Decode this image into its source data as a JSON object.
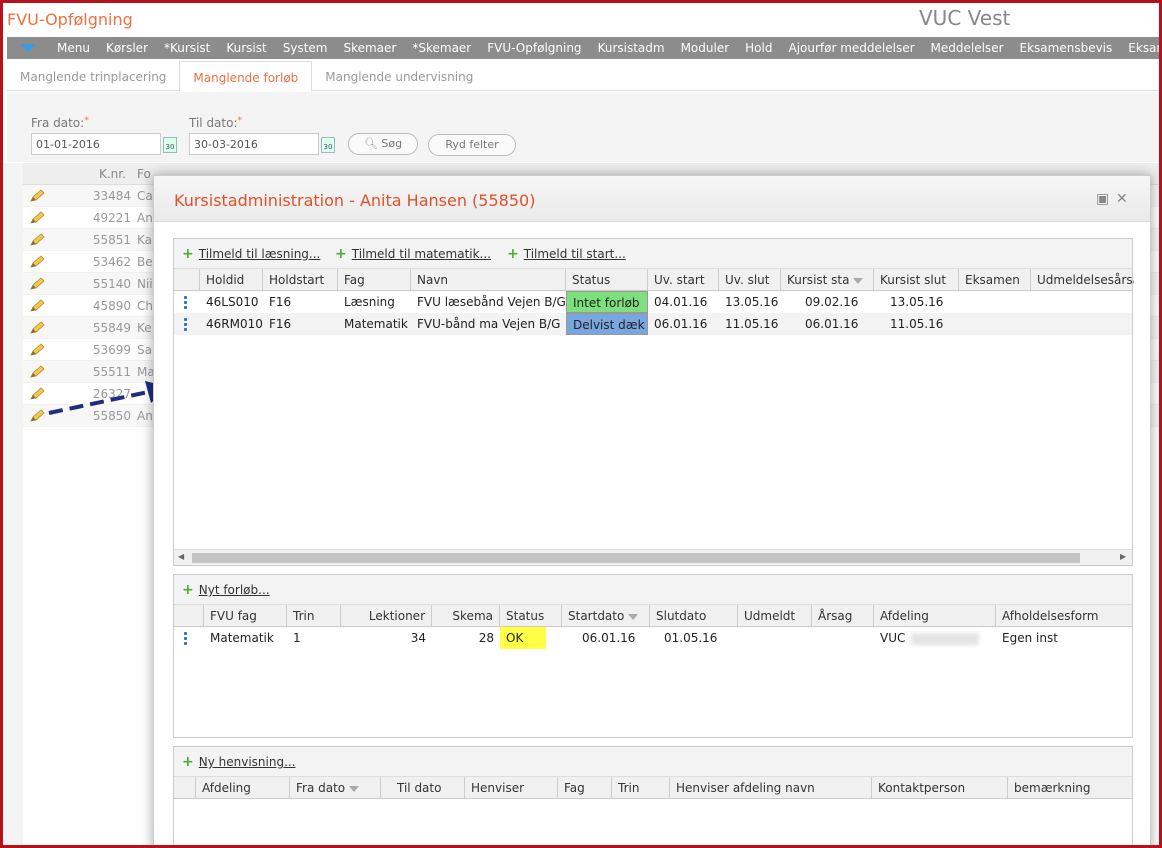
{
  "app_title": "FVU-Opfølgning",
  "org_name": "VUC Vest",
  "menu": [
    "Menu",
    "Kørsler",
    "*Kursist",
    "Kursist",
    "System",
    "Skemaer",
    "*Skemaer",
    "FVU-Opfølgning",
    "Kursistadm",
    "Moduler",
    "Hold",
    "Ajourfør meddelelser",
    "Meddelelser",
    "Eksamensbevis",
    "Eksamensplan"
  ],
  "subtabs": [
    "Manglende trinplacering",
    "Manglende forløb",
    "Manglende undervisning"
  ],
  "active_subtab": "Manglende forløb",
  "filters": {
    "from_label": "Fra dato:",
    "from_value": "01-01-2016",
    "to_label": "Til dato:",
    "to_value": "30-03-2016",
    "required_mark": "*",
    "search_label": "Søg",
    "clear_label": "Ryd felter"
  },
  "bg_grid": {
    "header_knr": "K.nr.",
    "header_name": "Fo",
    "rows": [
      {
        "knr": "33484",
        "name": "Ca"
      },
      {
        "knr": "49221",
        "name": "An"
      },
      {
        "knr": "55851",
        "name": "Ka"
      },
      {
        "knr": "53462",
        "name": "Be"
      },
      {
        "knr": "55140",
        "name": "Nii"
      },
      {
        "knr": "45890",
        "name": "Ch"
      },
      {
        "knr": "55849",
        "name": "Ke"
      },
      {
        "knr": "53699",
        "name": "Sa"
      },
      {
        "knr": "55511",
        "name": "Ma"
      },
      {
        "knr": "26327",
        "name": ""
      },
      {
        "knr": "55850",
        "name": "An"
      }
    ]
  },
  "modal": {
    "title": "Kursistadministration - Anita Hansen (55850)",
    "enroll_links": [
      "Tilmeld til læsning...",
      "Tilmeld til matematik...",
      "Tilmeld til start..."
    ],
    "hold_columns": [
      "Holdid",
      "Holdstart",
      "Fag",
      "Navn",
      "Status",
      "Uv. start",
      "Uv. slut",
      "Kursist sta",
      "Kursist slut",
      "Eksamen",
      "Udmeldelsesårsa"
    ],
    "hold_rows": [
      {
        "holdid": "46LS010",
        "holdstart": "F16",
        "fag": "Læsning",
        "navn": "FVU læsebånd Vejen B/G",
        "status": "Intet forløb",
        "status_color": "#7de07d",
        "uv_start": "04.01.16",
        "uv_slut": "13.05.16",
        "kursist_start": "09.02.16",
        "kursist_slut": "13.05.16"
      },
      {
        "holdid": "46RM010",
        "holdstart": "F16",
        "fag": "Matematik",
        "navn": "FVU-bånd ma Vejen B/G",
        "status": "Delvist dæk",
        "status_color": "#7aa6e0",
        "uv_start": "06.01.16",
        "uv_slut": "11.05.16",
        "kursist_start": "06.01.16",
        "kursist_slut": "11.05.16"
      }
    ],
    "forloeb_link": "Nyt forløb...",
    "forloeb_columns": [
      "FVU fag",
      "Trin",
      "Lektioner",
      "Skema",
      "Status",
      "Startdato",
      "Slutdato",
      "Udmeldt",
      "Årsag",
      "Afdeling",
      "Afholdelsesform"
    ],
    "forloeb_rows": [
      {
        "fag": "Matematik",
        "trin": "1",
        "lektioner": "34",
        "skema": "28",
        "status": "OK",
        "status_color": "#ffff44",
        "startdato": "06.01.16",
        "slutdato": "01.05.16",
        "afdeling": "VUC",
        "afholdelsesform": "Egen inst"
      }
    ],
    "henvisning_link": "Ny henvisning...",
    "henvisning_columns": [
      "Afdeling",
      "Fra dato",
      "Til dato",
      "Henviser",
      "Fag",
      "Trin",
      "Henviser afdeling navn",
      "Kontaktperson",
      "bemærkning"
    ]
  }
}
